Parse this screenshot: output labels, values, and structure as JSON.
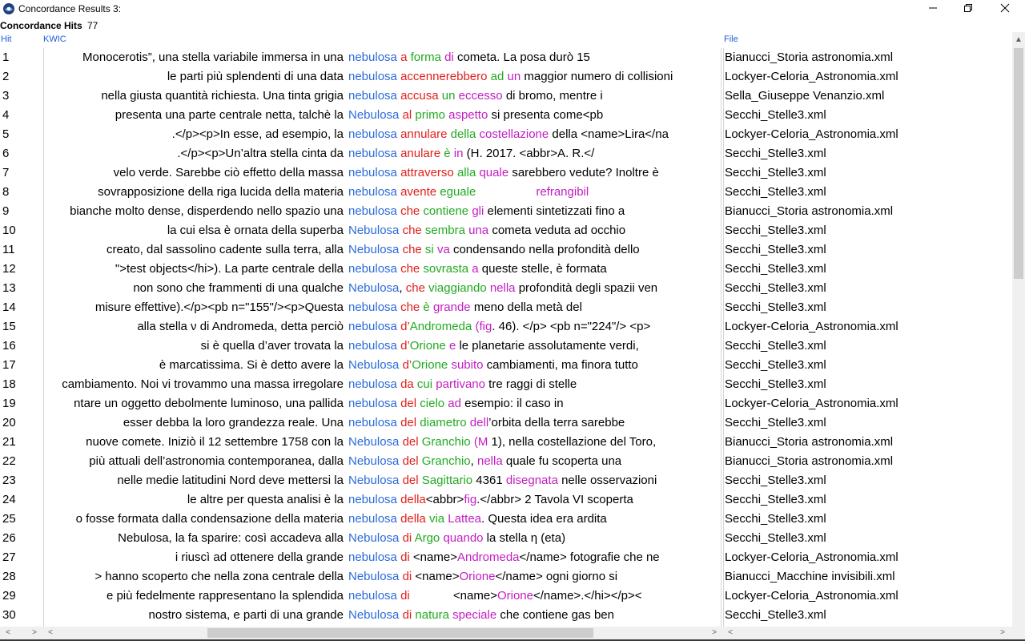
{
  "window": {
    "title": "Concordance Results 3:"
  },
  "status": {
    "label": "Concordance Hits",
    "count": "77"
  },
  "headers": {
    "hit": "Hit",
    "kwic": "KWIC",
    "file": "File"
  },
  "colors": {
    "node": "#2b6bd9",
    "r1": "#e0201c",
    "r2": "#22aa22",
    "r3": "#c21ec2",
    "header": "#1a5fd6"
  },
  "rows": [
    {
      "hit": "1",
      "left": "Monocerotis”, una stella variabile immersa in una",
      "right": [
        [
          "nebulosa",
          "node"
        ],
        [
          " "
        ],
        [
          "a",
          "r1"
        ],
        [
          " "
        ],
        [
          "forma",
          "r2"
        ],
        [
          " "
        ],
        [
          "di",
          "r3"
        ],
        [
          " cometa. La posa durò 15"
        ]
      ],
      "file": "Bianucci_Storia astronomia.xml"
    },
    {
      "hit": "2",
      "left": "le parti più splendenti di una data",
      "right": [
        [
          "nebulosa",
          "node"
        ],
        [
          " "
        ],
        [
          "accennerebbero",
          "r1"
        ],
        [
          " "
        ],
        [
          "ad",
          "r2"
        ],
        [
          " "
        ],
        [
          "un",
          "r3"
        ],
        [
          " maggior numero di collisioni"
        ]
      ],
      "file": "Lockyer-Celoria_Astronomia.xml"
    },
    {
      "hit": "3",
      "left": "nella giusta quantità richiesta. Una tinta grigia",
      "right": [
        [
          "nebulosa",
          "node"
        ],
        [
          " "
        ],
        [
          "accusa",
          "r1"
        ],
        [
          " "
        ],
        [
          "un",
          "r2"
        ],
        [
          " "
        ],
        [
          "eccesso",
          "r3"
        ],
        [
          " di bromo, mentre i"
        ]
      ],
      "file": "Sella_Giuseppe Venanzio.xml"
    },
    {
      "hit": "4",
      "left": "presenta una parte centrale netta, talchè la",
      "right": [
        [
          "Nebulosa",
          "node"
        ],
        [
          " "
        ],
        [
          "al",
          "r1"
        ],
        [
          " "
        ],
        [
          "primo",
          "r2"
        ],
        [
          " "
        ],
        [
          "aspetto",
          "r3"
        ],
        [
          " si presenta come<pb"
        ]
      ],
      "file": "Secchi_Stelle3.xml"
    },
    {
      "hit": "5",
      "left": ".</p><p>In esse, ad esempio, la",
      "right": [
        [
          "nebulosa",
          "node"
        ],
        [
          " "
        ],
        [
          "annulare",
          "r1"
        ],
        [
          " "
        ],
        [
          "della",
          "r2"
        ],
        [
          " "
        ],
        [
          "costellazione",
          "r3"
        ],
        [
          " della <name>Lira</na"
        ]
      ],
      "file": "Lockyer-Celoria_Astronomia.xml"
    },
    {
      "hit": "6",
      "left": ".</p><p>Un’altra stella cinta da",
      "right": [
        [
          "nebulosa",
          "node"
        ],
        [
          " "
        ],
        [
          "anulare",
          "r1"
        ],
        [
          " "
        ],
        [
          "è",
          "r2"
        ],
        [
          " "
        ],
        [
          "in",
          "r3"
        ],
        [
          " (H. 2017. <abbr>A. R.</"
        ]
      ],
      "file": "Secchi_Stelle3.xml"
    },
    {
      "hit": "7",
      "left": "velo verde. Sarebbe ciò effetto della massa",
      "right": [
        [
          "nebulosa",
          "node"
        ],
        [
          " "
        ],
        [
          "attraverso",
          "r1"
        ],
        [
          " "
        ],
        [
          "alla",
          "r2"
        ],
        [
          " "
        ],
        [
          "quale",
          "r3"
        ],
        [
          " sarebbero vedute? Inoltre è"
        ]
      ],
      "file": "Secchi_Stelle3.xml"
    },
    {
      "hit": "8",
      "left": "sovrapposizione della riga lucida della materia",
      "right": [
        [
          "nebulosa",
          "node"
        ],
        [
          " "
        ],
        [
          "avente",
          "r1"
        ],
        [
          " "
        ],
        [
          "eguale",
          "r2"
        ],
        [
          "                  "
        ],
        [
          "refrangibil",
          "r3"
        ]
      ],
      "file": "Secchi_Stelle3.xml"
    },
    {
      "hit": "9",
      "left": "bianche molto dense, disperdendo nello spazio una",
      "right": [
        [
          "nebulosa",
          "node"
        ],
        [
          " "
        ],
        [
          "che",
          "r1"
        ],
        [
          " "
        ],
        [
          "contiene",
          "r2"
        ],
        [
          " "
        ],
        [
          "gli",
          "r3"
        ],
        [
          " elementi sintetizzati fino a"
        ]
      ],
      "file": "Bianucci_Storia astronomia.xml"
    },
    {
      "hit": "10",
      "left": "la cui elsa è ornata della superba",
      "right": [
        [
          "Nebulosa",
          "node"
        ],
        [
          " "
        ],
        [
          "che",
          "r1"
        ],
        [
          " "
        ],
        [
          "sembra",
          "r2"
        ],
        [
          " "
        ],
        [
          "una",
          "r3"
        ],
        [
          " cometa veduta ad occhio"
        ]
      ],
      "file": "Secchi_Stelle3.xml"
    },
    {
      "hit": "11",
      "left": "creato, dal sassolino cadente sulla terra, alla",
      "right": [
        [
          "Nebulosa",
          "node"
        ],
        [
          " "
        ],
        [
          "che",
          "r1"
        ],
        [
          " "
        ],
        [
          "si",
          "r2"
        ],
        [
          " "
        ],
        [
          "va",
          "r3"
        ],
        [
          " condensando nella profondità dello"
        ]
      ],
      "file": "Secchi_Stelle3.xml"
    },
    {
      "hit": "12",
      "left": "\">test objects</hi>). La parte centrale della",
      "right": [
        [
          "nebulosa",
          "node"
        ],
        [
          " "
        ],
        [
          "che",
          "r1"
        ],
        [
          " "
        ],
        [
          "sovrasta",
          "r2"
        ],
        [
          " "
        ],
        [
          "a",
          "r3"
        ],
        [
          " queste stelle, è formata"
        ]
      ],
      "file": "Secchi_Stelle3.xml"
    },
    {
      "hit": "13",
      "left": "non sono che frammenti di una qualche",
      "right": [
        [
          "Nebulosa",
          "node"
        ],
        [
          ", "
        ],
        [
          "che",
          "r1"
        ],
        [
          " "
        ],
        [
          "viaggiando",
          "r2"
        ],
        [
          " "
        ],
        [
          "nella",
          "r3"
        ],
        [
          " profondità degli spazii ven"
        ]
      ],
      "file": "Secchi_Stelle3.xml"
    },
    {
      "hit": "14",
      "left": "misure effettive).</p><pb n=\"155\"/><p>Questa",
      "right": [
        [
          "nebulosa",
          "node"
        ],
        [
          " "
        ],
        [
          "che",
          "r1"
        ],
        [
          " "
        ],
        [
          "è",
          "r2"
        ],
        [
          " "
        ],
        [
          "grande",
          "r3"
        ],
        [
          " meno della metà del"
        ]
      ],
      "file": "Secchi_Stelle3.xml"
    },
    {
      "hit": "15",
      "left": "alla stella ν di Andromeda, detta perciò",
      "right": [
        [
          "nebulosa",
          "node"
        ],
        [
          " "
        ],
        [
          "d’",
          "r1"
        ],
        [
          "Andromeda",
          "r2"
        ],
        [
          " "
        ],
        [
          "(",
          "r3"
        ],
        [
          "fig",
          "r3"
        ],
        [
          ". 46). </p> <pb n=\"224\"/> <p>"
        ]
      ],
      "file": "Lockyer-Celoria_Astronomia.xml"
    },
    {
      "hit": "16",
      "left": "si è quella d’aver trovata la",
      "right": [
        [
          "nebulosa",
          "node"
        ],
        [
          " "
        ],
        [
          "d’",
          "r1"
        ],
        [
          "Orione",
          "r2"
        ],
        [
          " "
        ],
        [
          "e",
          "r3"
        ],
        [
          " le planetarie assolutamente verdi,"
        ]
      ],
      "file": "Secchi_Stelle3.xml"
    },
    {
      "hit": "17",
      "left": "è marcatissima. Si è detto avere la",
      "right": [
        [
          "Nebulosa",
          "node"
        ],
        [
          " "
        ],
        [
          "d’",
          "r1"
        ],
        [
          "Orione",
          "r2"
        ],
        [
          " "
        ],
        [
          "subito",
          "r3"
        ],
        [
          " cambiamenti, ma finora tutto"
        ]
      ],
      "file": "Secchi_Stelle3.xml"
    },
    {
      "hit": "18",
      "left": "cambiamento. Noi vi trovammo una massa irregolare",
      "right": [
        [
          "nebulosa",
          "node"
        ],
        [
          " "
        ],
        [
          "da",
          "r1"
        ],
        [
          " "
        ],
        [
          "cui",
          "r2"
        ],
        [
          " "
        ],
        [
          "partivano",
          "r3"
        ],
        [
          " tre raggi di stelle"
        ]
      ],
      "file": "Secchi_Stelle3.xml"
    },
    {
      "hit": "19",
      "left": "ntare un oggetto debolmente luminoso, una pallida",
      "right": [
        [
          "nebulosa",
          "node"
        ],
        [
          " "
        ],
        [
          "del",
          "r1"
        ],
        [
          " "
        ],
        [
          "cielo",
          "r2"
        ],
        [
          " "
        ],
        [
          "ad",
          "r3"
        ],
        [
          " esempio: il caso in"
        ]
      ],
      "file": "Lockyer-Celoria_Astronomia.xml"
    },
    {
      "hit": "20",
      "left": "esser debba la loro grandezza reale. Una",
      "right": [
        [
          "nebulosa",
          "node"
        ],
        [
          " "
        ],
        [
          "del",
          "r1"
        ],
        [
          " "
        ],
        [
          "diametro",
          "r2"
        ],
        [
          " "
        ],
        [
          "dell",
          "r3"
        ],
        [
          "’orbita della terra sarebbe"
        ]
      ],
      "file": "Secchi_Stelle3.xml"
    },
    {
      "hit": "21",
      "left": "nuove comete. Iniziò il 12 settembre 1758 con la",
      "right": [
        [
          "Nebulosa",
          "node"
        ],
        [
          " "
        ],
        [
          "del",
          "r1"
        ],
        [
          " "
        ],
        [
          "Granchio",
          "r2"
        ],
        [
          " "
        ],
        [
          "(",
          "r3"
        ],
        [
          "M",
          "r3"
        ],
        [
          " 1), nella costellazione del Toro,"
        ]
      ],
      "file": "Bianucci_Storia astronomia.xml"
    },
    {
      "hit": "22",
      "left": "più attuali dell’astronomia contemporanea, dalla",
      "right": [
        [
          "Nebulosa",
          "node"
        ],
        [
          " "
        ],
        [
          "del",
          "r1"
        ],
        [
          " "
        ],
        [
          "Granchio",
          "r2"
        ],
        [
          ", "
        ],
        [
          "nella",
          "r3"
        ],
        [
          " quale fu scoperta una"
        ]
      ],
      "file": "Bianucci_Storia astronomia.xml"
    },
    {
      "hit": "23",
      "left": "nelle medie latitudini Nord deve mettersi la",
      "right": [
        [
          "Nebulosa",
          "node"
        ],
        [
          " "
        ],
        [
          "del",
          "r1"
        ],
        [
          " "
        ],
        [
          "Sagittario",
          "r2"
        ],
        [
          " 4361 "
        ],
        [
          "disegnata",
          "r3"
        ],
        [
          " nelle osservazioni"
        ]
      ],
      "file": "Secchi_Stelle3.xml"
    },
    {
      "hit": "24",
      "left": "le altre per questa analisi è la",
      "right": [
        [
          "nebulosa",
          "node"
        ],
        [
          " "
        ],
        [
          "della",
          "r1"
        ],
        [
          "<abbr>"
        ],
        [
          "fig",
          "r3"
        ],
        [
          ".</abbr> 2 Tavola VI scoperta"
        ]
      ],
      "file": "Secchi_Stelle3.xml"
    },
    {
      "hit": "25",
      "left": "o fosse formata dalla condensazione della materia",
      "right": [
        [
          "nebulosa",
          "node"
        ],
        [
          " "
        ],
        [
          "della",
          "r1"
        ],
        [
          " "
        ],
        [
          "via",
          "r2"
        ],
        [
          " "
        ],
        [
          "Lattea",
          "r3"
        ],
        [
          ". Questa idea era ardita"
        ]
      ],
      "file": "Secchi_Stelle3.xml"
    },
    {
      "hit": "26",
      "left": "Nebulosa, la fa sparire: così accadeva alla",
      "right": [
        [
          "Nebulosa",
          "node"
        ],
        [
          " "
        ],
        [
          "di",
          "r1"
        ],
        [
          " "
        ],
        [
          "Argo",
          "r2"
        ],
        [
          " "
        ],
        [
          "quando",
          "r3"
        ],
        [
          " la stella η (eta)"
        ]
      ],
      "file": "Secchi_Stelle3.xml"
    },
    {
      "hit": "27",
      "left": "i              riuscì ad ottenere della grande",
      "right": [
        [
          "nebulosa",
          "node"
        ],
        [
          " "
        ],
        [
          "di",
          "r1"
        ],
        [
          " <name>"
        ],
        [
          "Andromeda",
          "r3"
        ],
        [
          "</name> fotografie che ne"
        ]
      ],
      "file": "Lockyer-Celoria_Astronomia.xml"
    },
    {
      "hit": "28",
      "left": "> hanno scoperto che nella zona centrale della",
      "right": [
        [
          "Nebulosa",
          "node"
        ],
        [
          " "
        ],
        [
          "di",
          "r1"
        ],
        [
          " <name>"
        ],
        [
          "Orione",
          "r3"
        ],
        [
          "</name> ogni giorno si"
        ]
      ],
      "file": "Bianucci_Macchine invisibili.xml"
    },
    {
      "hit": "29",
      "left": "e più fedelmente rappresentano la splendida",
      "right": [
        [
          "nebulosa",
          "node"
        ],
        [
          " "
        ],
        [
          "di",
          "r1"
        ],
        [
          "             <name>"
        ],
        [
          "Orione",
          "r3"
        ],
        [
          "</name>.</hi></p><"
        ]
      ],
      "file": "Lockyer-Celoria_Astronomia.xml"
    },
    {
      "hit": "30",
      "left": "nostro sistema, e parti di una grande",
      "right": [
        [
          "Nebulosa",
          "node"
        ],
        [
          " "
        ],
        [
          "di",
          "r1"
        ],
        [
          " "
        ],
        [
          "natura",
          "r2"
        ],
        [
          " "
        ],
        [
          "speciale",
          "r3"
        ],
        [
          " che contiene gas ben"
        ]
      ],
      "file": "Secchi_Stelle3.xml"
    }
  ]
}
